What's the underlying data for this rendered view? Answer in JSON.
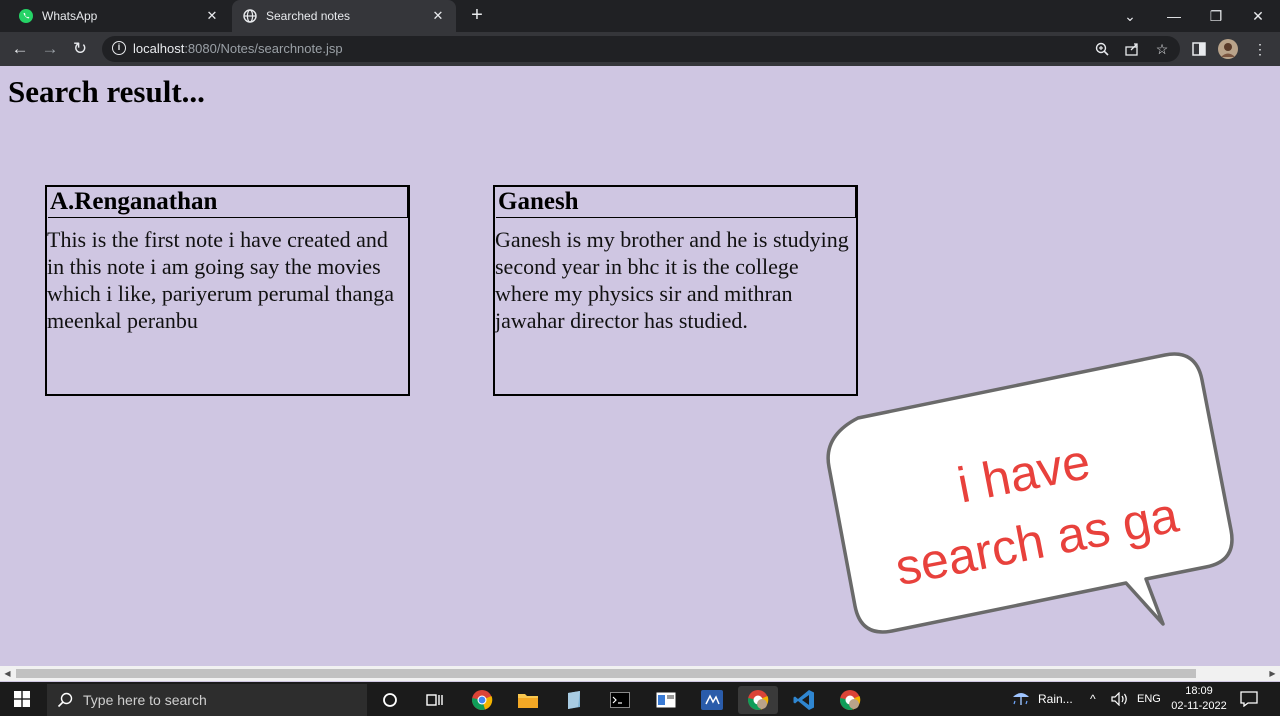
{
  "browser": {
    "tabs": [
      {
        "label": "WhatsApp",
        "icon": "whatsapp-icon",
        "active": false
      },
      {
        "label": "Searched notes",
        "icon": "globe-icon",
        "active": true
      }
    ],
    "url_host": "localhost",
    "url_rest": ":8080/Notes/searchnote.jsp"
  },
  "page": {
    "heading": "Search result...",
    "notes": [
      {
        "title": "A.Renganathan",
        "body": "This is the first note i have created and in this note i am going say the movies which i like, pariyerum perumal thanga meenkal peranbu"
      },
      {
        "title": "Ganesh",
        "body": "Ganesh is my brother and he is studying second year in bhc it is the college where my physics sir and mithran jawahar director has studied."
      }
    ]
  },
  "annotation": {
    "line1": "i have",
    "line2": "search as ga",
    "text_color": "#e8413c"
  },
  "taskbar": {
    "search_placeholder": "Type here to search",
    "weather": "Rain...",
    "language": "ENG",
    "time": "18:09",
    "date": "02-11-2022"
  },
  "colors": {
    "page_background": "#cfc6e2",
    "chrome_dark": "#202124",
    "chrome_toolbar": "#35363a"
  }
}
